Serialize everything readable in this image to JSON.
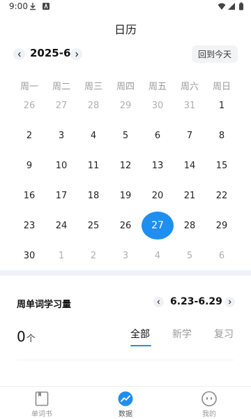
{
  "status_bar": {
    "time": "9:00"
  },
  "header": {
    "title": "日历"
  },
  "calendar": {
    "month_label": "2025-6",
    "today_button": "回到今天",
    "weekdays": [
      "周一",
      "周二",
      "周三",
      "周四",
      "周五",
      "周六",
      "周日"
    ],
    "rows": [
      [
        {
          "d": "26",
          "other": true
        },
        {
          "d": "27",
          "other": true
        },
        {
          "d": "28",
          "other": true
        },
        {
          "d": "29",
          "other": true
        },
        {
          "d": "30",
          "other": true
        },
        {
          "d": "31",
          "other": true
        },
        {
          "d": "1",
          "other": false
        }
      ],
      [
        {
          "d": "2",
          "other": false
        },
        {
          "d": "3",
          "other": false
        },
        {
          "d": "4",
          "other": false
        },
        {
          "d": "5",
          "other": false
        },
        {
          "d": "6",
          "other": false
        },
        {
          "d": "7",
          "other": false
        },
        {
          "d": "8",
          "other": false
        }
      ],
      [
        {
          "d": "9",
          "other": false
        },
        {
          "d": "10",
          "other": false
        },
        {
          "d": "11",
          "other": false
        },
        {
          "d": "12",
          "other": false
        },
        {
          "d": "13",
          "other": false
        },
        {
          "d": "14",
          "other": false
        },
        {
          "d": "15",
          "other": false
        }
      ],
      [
        {
          "d": "16",
          "other": false
        },
        {
          "d": "17",
          "other": false
        },
        {
          "d": "18",
          "other": false
        },
        {
          "d": "19",
          "other": false
        },
        {
          "d": "20",
          "other": false
        },
        {
          "d": "21",
          "other": false
        },
        {
          "d": "22",
          "other": false
        }
      ],
      [
        {
          "d": "23",
          "other": false
        },
        {
          "d": "24",
          "other": false
        },
        {
          "d": "25",
          "other": false
        },
        {
          "d": "26",
          "other": false
        },
        {
          "d": "27",
          "other": false,
          "selected": true
        },
        {
          "d": "28",
          "other": false
        },
        {
          "d": "29",
          "other": false
        }
      ],
      [
        {
          "d": "30",
          "other": false
        },
        {
          "d": "1",
          "other": true
        },
        {
          "d": "2",
          "other": true
        },
        {
          "d": "3",
          "other": true
        },
        {
          "d": "4",
          "other": true
        },
        {
          "d": "5",
          "other": true
        },
        {
          "d": "6",
          "other": true
        }
      ]
    ],
    "accent_color": "#1e8ff0"
  },
  "stats": {
    "title": "周单词学习量",
    "week_range": "6.23-6.29",
    "count": "0",
    "count_unit": "个",
    "tabs": [
      "全部",
      "新学",
      "复习"
    ],
    "active_tab": "全部"
  },
  "bottom_nav": {
    "items": [
      {
        "label": "单词书",
        "icon": "book-icon"
      },
      {
        "label": "数据",
        "icon": "stats-icon"
      },
      {
        "label": "我的",
        "icon": "profile-icon"
      }
    ],
    "active": "数据"
  }
}
